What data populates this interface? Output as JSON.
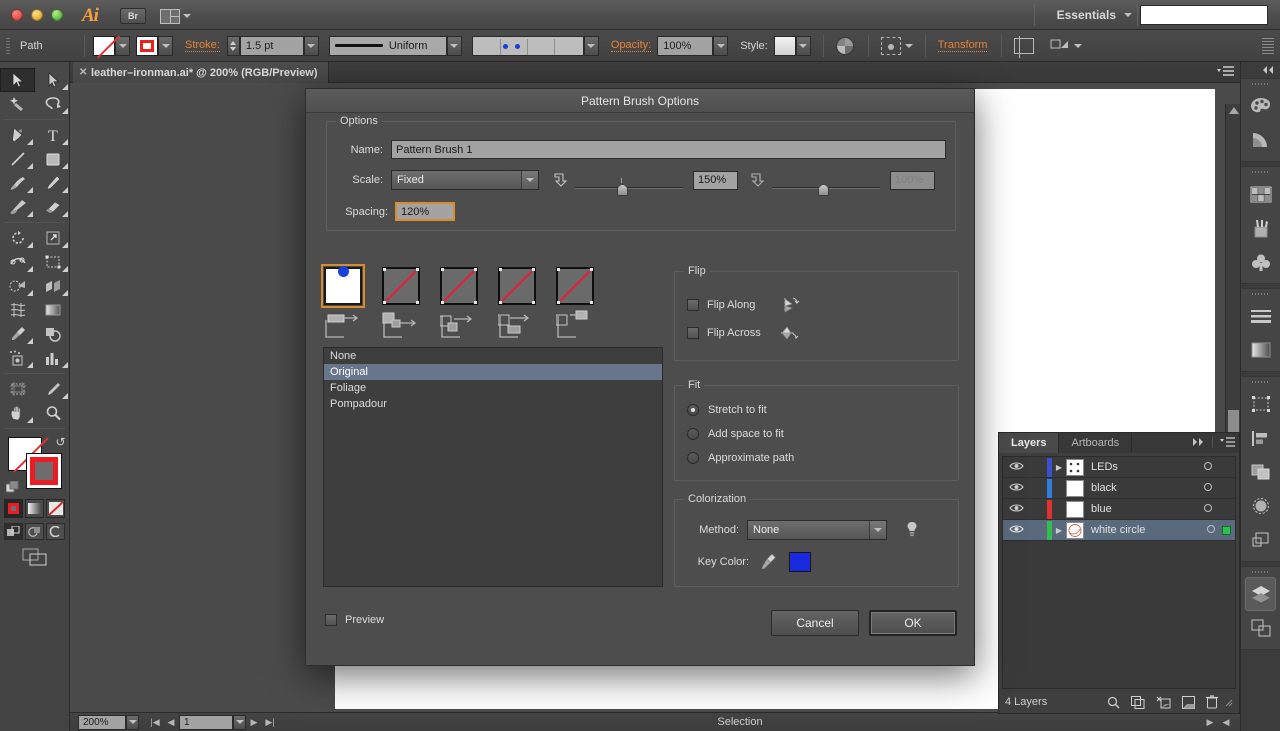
{
  "app": {
    "name": "Adobe Illustrator",
    "logo_text": "Ai",
    "bridge_label": "Br",
    "workspace_label": "Essentials",
    "search_placeholder": ""
  },
  "control_bar": {
    "object_type": "Path",
    "fill_label": "fill-swatch",
    "stroke_label": "stroke-swatch",
    "stroke_text": "Stroke:",
    "stroke_weight": "1.5 pt",
    "profile_name": "Uniform",
    "brush_name": "brush-definition",
    "opacity_text": "Opacity:",
    "opacity_value": "100%",
    "style_text": "Style:",
    "transform_text": "Transform",
    "isolate_icon": "isolate-icon",
    "align_icon": "align-icon",
    "select_similar_icon": "select-similar-icon"
  },
  "document": {
    "tab_title": "leather–ironman.ai* @ 200% (RGB/Preview)",
    "close_label": "✕"
  },
  "status_bar": {
    "zoom": "200%",
    "page": "1",
    "tool_status": "Selection"
  },
  "toolbox": {
    "tools": [
      {
        "name": "selection-tool",
        "selected": true
      },
      {
        "name": "direct-selection-tool",
        "selected": false
      },
      {
        "name": "magic-wand-tool",
        "selected": false
      },
      {
        "name": "lasso-tool",
        "selected": false
      },
      {
        "name": "pen-tool",
        "selected": false
      },
      {
        "name": "type-tool",
        "selected": false
      },
      {
        "name": "line-segment-tool",
        "selected": false
      },
      {
        "name": "rectangle-tool",
        "selected": false
      },
      {
        "name": "paintbrush-tool",
        "selected": false
      },
      {
        "name": "pencil-tool",
        "selected": false
      },
      {
        "name": "blob-brush-tool",
        "selected": false
      },
      {
        "name": "eraser-tool",
        "selected": false
      },
      {
        "name": "rotate-tool",
        "selected": false
      },
      {
        "name": "scale-tool",
        "selected": false
      },
      {
        "name": "width-tool",
        "selected": false
      },
      {
        "name": "free-transform-tool",
        "selected": false
      },
      {
        "name": "shape-builder-tool",
        "selected": false
      },
      {
        "name": "perspective-grid-tool",
        "selected": false
      },
      {
        "name": "mesh-tool",
        "selected": false
      },
      {
        "name": "gradient-tool",
        "selected": false
      },
      {
        "name": "eyedropper-tool",
        "selected": false
      },
      {
        "name": "blend-tool",
        "selected": false
      },
      {
        "name": "symbol-sprayer-tool",
        "selected": false
      },
      {
        "name": "column-graph-tool",
        "selected": false
      },
      {
        "name": "artboard-tool",
        "selected": false
      },
      {
        "name": "slice-tool",
        "selected": false
      },
      {
        "name": "hand-tool",
        "selected": false
      },
      {
        "name": "zoom-tool",
        "selected": false
      }
    ],
    "fill_color": "#ffffff",
    "stroke_color": "#ed1c24",
    "color_modes": [
      "color-button",
      "gradient-button",
      "none-button"
    ],
    "draw_modes": [
      "draw-normal",
      "draw-behind",
      "draw-inside"
    ],
    "screen_mode": "change-screen-mode"
  },
  "dialog": {
    "title": "Pattern Brush Options",
    "options_legend": "Options",
    "name_label": "Name:",
    "name_value": "Pattern Brush 1",
    "scale_label": "Scale:",
    "scale_value": "Fixed",
    "scale_slider_value": "150%",
    "scale_slider2_value": "100%",
    "spacing_label": "Spacing:",
    "spacing_value": "120%",
    "tiles": [
      {
        "name": "side-tile",
        "selected": true,
        "art": "blue-dot"
      },
      {
        "name": "outer-corner-tile",
        "selected": false,
        "art": "diagonal-line"
      },
      {
        "name": "inner-corner-tile",
        "selected": false,
        "art": "diagonal-line"
      },
      {
        "name": "start-tile",
        "selected": false,
        "art": "diagonal-line"
      },
      {
        "name": "end-tile",
        "selected": false,
        "art": "diagonal-line"
      }
    ],
    "tile_list": [
      "None",
      "Original",
      "Foliage",
      "Pompadour"
    ],
    "tile_list_selected": "Original",
    "flip": {
      "legend": "Flip",
      "flip_along_label": "Flip Along",
      "flip_along_checked": false,
      "flip_across_label": "Flip Across",
      "flip_across_checked": false
    },
    "fit": {
      "legend": "Fit",
      "options": [
        "Stretch to fit",
        "Add space to fit",
        "Approximate path"
      ],
      "selected": "Stretch to fit"
    },
    "colorization": {
      "legend": "Colorization",
      "method_label": "Method:",
      "method_value": "None",
      "key_color_label": "Key Color:",
      "key_color": "#1a2ae0",
      "eyedropper_icon": "eyedropper-icon",
      "tip_icon": "lightbulb-icon"
    },
    "preview_label": "Preview",
    "preview_checked": false,
    "cancel_label": "Cancel",
    "ok_label": "OK"
  },
  "layers_panel": {
    "tabs": [
      {
        "label": "Layers",
        "active": true
      },
      {
        "label": "Artboards",
        "active": false
      }
    ],
    "layers": [
      {
        "name": "LEDs",
        "color": "#3b4fd0",
        "selected": false,
        "has_arrow": true,
        "targeted": false
      },
      {
        "name": "black",
        "color": "#2f7fe0",
        "selected": false,
        "has_arrow": false,
        "targeted": false
      },
      {
        "name": "blue",
        "color": "#e03232",
        "selected": false,
        "has_arrow": false,
        "targeted": false
      },
      {
        "name": "white circle",
        "color": "#2fbf4f",
        "selected": true,
        "has_arrow": true,
        "targeted": true
      }
    ],
    "footer_count": "4 Layers",
    "footer_icons": [
      "locate-object-icon",
      "make-clipping-mask-icon",
      "create-new-sublayer-icon",
      "create-new-layer-icon",
      "delete-selection-icon"
    ]
  },
  "dock": {
    "groups": [
      [
        "color-panel-icon",
        "color-guide-panel-icon"
      ],
      [
        "swatches-panel-icon",
        "brushes-panel-icon",
        "symbols-panel-icon"
      ],
      [
        "stroke-panel-icon",
        "gradient-panel-icon"
      ],
      [
        "transform-panel-icon",
        "align-panel-icon",
        "pathfinder-panel-icon",
        "transparency-panel-icon",
        "appearance-panel-icon"
      ],
      [
        "layers-panel-icon",
        "artboards-panel-icon"
      ]
    ]
  }
}
